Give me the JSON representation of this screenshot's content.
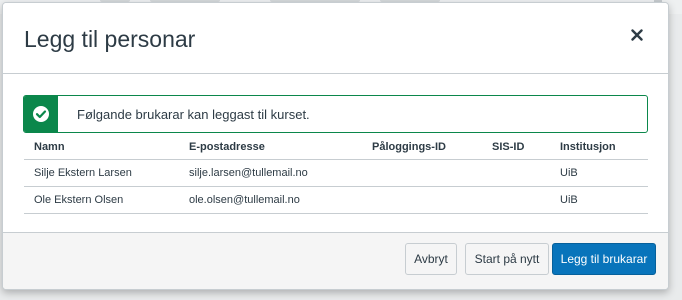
{
  "dialog": {
    "title": "Legg til personar"
  },
  "alert": {
    "message": "Følgande brukarar kan leggast til kurset.",
    "color": "#0b874b",
    "icon": "check-circle-icon"
  },
  "table": {
    "headers": [
      "Namn",
      "E-postadresse",
      "Påloggings-ID",
      "SIS-ID",
      "Institusjon"
    ],
    "rows": [
      [
        "Silje Ekstern Larsen",
        "silje.larsen@tullemail.no",
        "",
        "",
        "UiB"
      ],
      [
        "Ole Ekstern Olsen",
        "ole.olsen@tullemail.no",
        "",
        "",
        "UiB"
      ]
    ]
  },
  "footer": {
    "cancel_label": "Avbryt",
    "restart_label": "Start på nytt",
    "add_label": "Legg til brukarar",
    "primary_color": "#0874bb"
  }
}
